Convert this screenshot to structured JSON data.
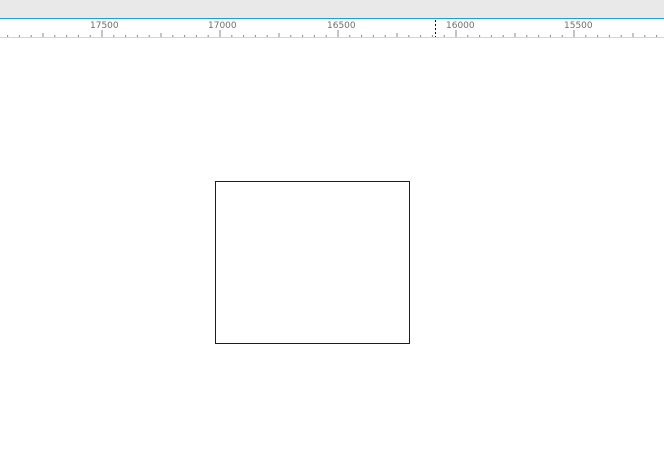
{
  "ruler": {
    "labels": [
      "17500",
      "17000",
      "16500",
      "16000",
      "15500"
    ],
    "colors": {
      "accent": "#1aa0dc",
      "tick": "#8a8a8a",
      "label": "#6f6f6f"
    }
  },
  "canvas": {
    "shapes": [
      {
        "type": "rectangle",
        "stroke": "#1e1e1e",
        "fill": "none"
      }
    ]
  }
}
